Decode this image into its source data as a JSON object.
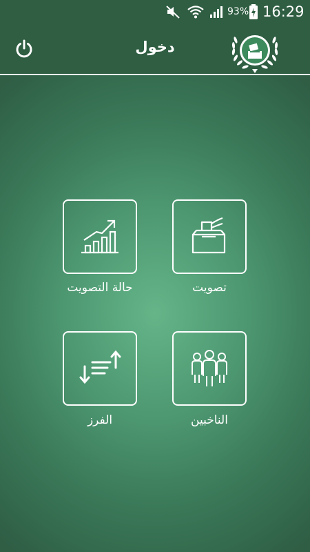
{
  "status_bar": {
    "battery_percent": "93%",
    "time": "16:29",
    "icons": [
      "mute-icon",
      "wifi-icon",
      "signal-icon",
      "battery-charging-icon"
    ]
  },
  "app_bar": {
    "title": "دخول",
    "icons": [
      "power-icon",
      "ballot-box-logo-icon"
    ]
  },
  "menu": {
    "items": [
      {
        "label": "تصويت",
        "icon": "ballot-box-icon"
      },
      {
        "label": "حالة التصويت",
        "icon": "bar-chart-trend-icon"
      },
      {
        "label": "الناخبين",
        "icon": "voters-group-icon"
      },
      {
        "label": "الفرز",
        "icon": "sort-arrows-icon"
      }
    ]
  },
  "colors": {
    "header_bg": "#2f5e42",
    "main_center": "#65b589",
    "main_edge": "#2f5e45",
    "foreground": "#ffffff"
  }
}
